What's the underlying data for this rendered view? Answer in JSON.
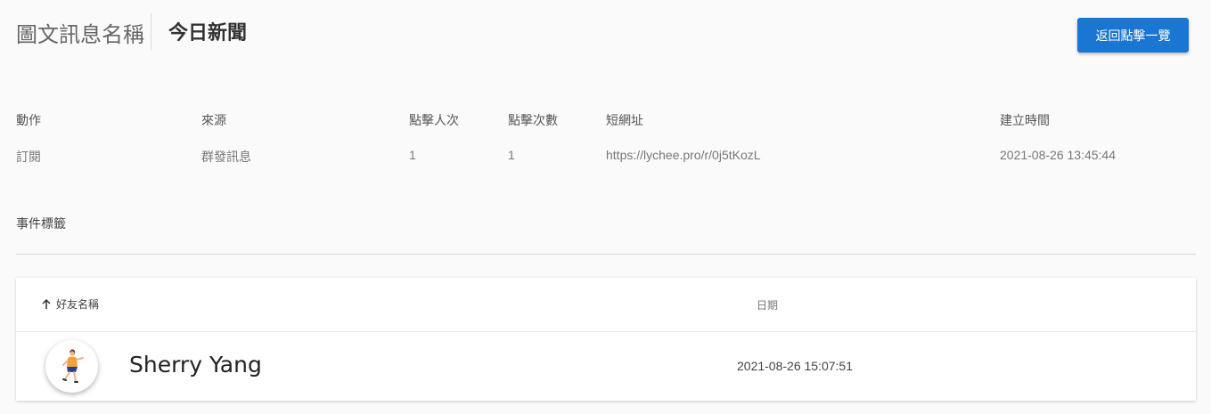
{
  "header": {
    "section_label": "圖文訊息名稱",
    "title": "今日新聞",
    "back_button": "返回點擊一覽"
  },
  "info": {
    "headers": {
      "action": "動作",
      "source": "來源",
      "click_people": "點擊人次",
      "click_count": "點擊次數",
      "short_url": "短網址",
      "created_at": "建立時間"
    },
    "values": {
      "action": "訂閱",
      "source": "群發訊息",
      "click_people": "1",
      "click_count": "1",
      "short_url": "https://lychee.pro/r/0j5tKozL",
      "created_at": "2021-08-26 13:45:44"
    }
  },
  "tags": {
    "label": "事件標籤"
  },
  "table": {
    "columns": {
      "friend_name": "好友名稱",
      "date": "日期"
    },
    "rows": [
      {
        "name": "Sherry Yang",
        "date": "2021-08-26 15:07:51"
      }
    ]
  },
  "colors": {
    "primary": "#1976d2",
    "background": "#fafafa"
  }
}
